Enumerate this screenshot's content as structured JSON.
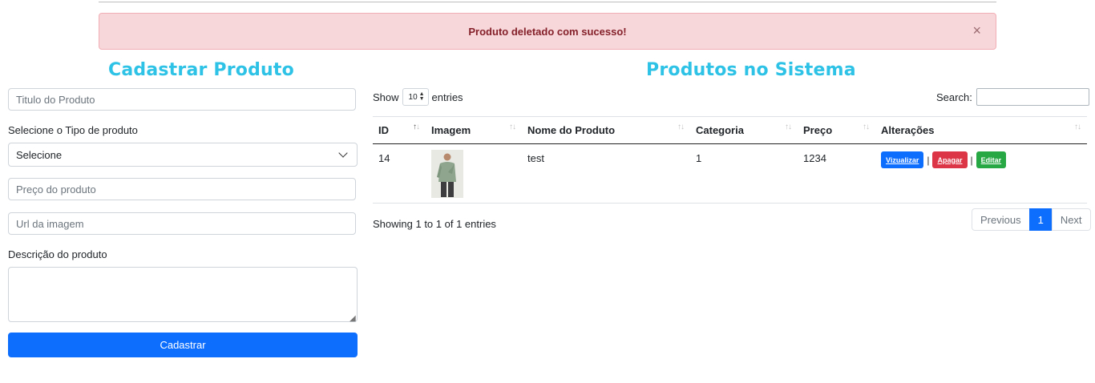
{
  "alert": {
    "message": "Produto deletado com sucesso!",
    "close": "×"
  },
  "form": {
    "title": "Cadastrar Produto",
    "title_placeholder": "Titulo do Produto",
    "type_label": "Selecione o Tipo de produto",
    "type_selected": "Selecione",
    "price_placeholder": "Preço do produto",
    "image_placeholder": "Url da imagem",
    "description_label": "Descrição do produto",
    "submit": "Cadastrar"
  },
  "table": {
    "title": "Produtos no Sistema",
    "show_label": "Show",
    "entries_value": "10",
    "entries_label": "entries",
    "search_label": "Search:",
    "columns": [
      "ID",
      "Imagem",
      "Nome do Produto",
      "Categoria",
      "Preço",
      "Alterações"
    ],
    "rows": [
      {
        "id": "14",
        "name": "test",
        "category": "1",
        "price": "1234"
      }
    ],
    "actions": {
      "view": "Vizualizar",
      "delete": "Apagar",
      "edit": "Editar",
      "sep": "|"
    },
    "info": "Showing 1 to 1 of 1 entries",
    "pagination": {
      "previous": "Previous",
      "page": "1",
      "next": "Next"
    }
  },
  "colors": {
    "accent": "#2ec3e6",
    "primary": "#0d6efd",
    "danger": "#dc3545",
    "success": "#28a745",
    "alert_bg": "#f8d7da"
  }
}
